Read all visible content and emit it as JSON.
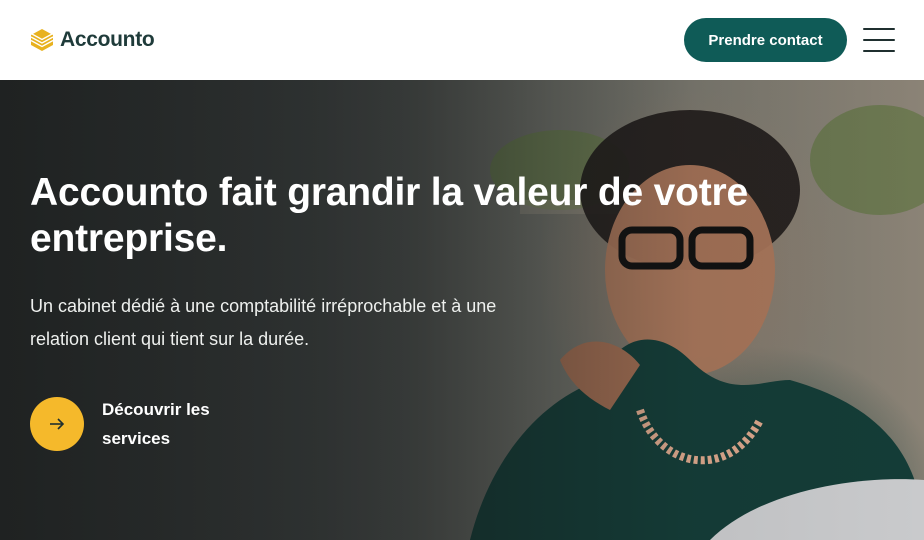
{
  "header": {
    "logo_text": "Accounto",
    "cta_label": "Prendre contact",
    "menu_icon": "hamburger-menu-icon"
  },
  "hero": {
    "title": "Accounto fait grandir la valeur de votre entreprise.",
    "subtitle": "Un cabinet dédié à une comptabilité irréprochable et à une relation client qui tient sur la durée.",
    "discover_label": "Découvrir les services",
    "discover_icon": "arrow-right-icon"
  },
  "colors": {
    "brand_dark": "#0f5b57",
    "accent_yellow": "#f5b92b",
    "logo_gold": "#e8b21f"
  }
}
